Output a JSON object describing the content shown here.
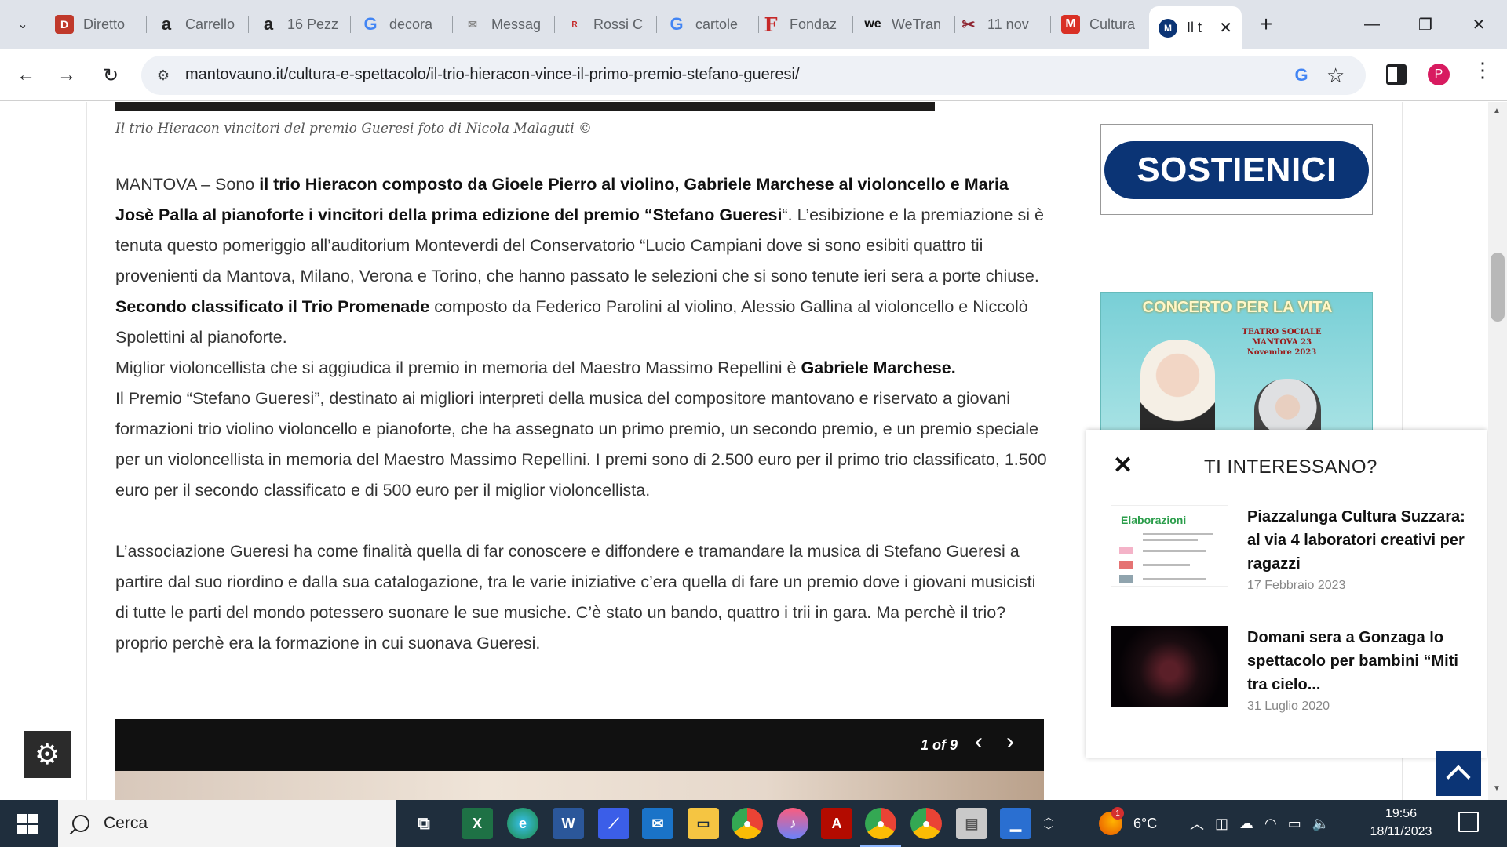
{
  "browser": {
    "tabs": [
      {
        "title": "Diretto",
        "favicon": "bookmark-icon",
        "fav_char": "D",
        "fav_color": "#c0392b"
      },
      {
        "title": "Carrello",
        "favicon": "amazon-icon",
        "fav_char": "a",
        "fav_color": "#222222"
      },
      {
        "title": "16 Pezz",
        "favicon": "amazon-icon",
        "fav_char": "a",
        "fav_color": "#222222"
      },
      {
        "title": "decora",
        "favicon": "google-icon",
        "fav_char": "G",
        "fav_color": "#4285f4"
      },
      {
        "title": "Messag",
        "favicon": "message-icon",
        "fav_char": "✉",
        "fav_color": "#888888"
      },
      {
        "title": "Rossi C",
        "favicon": "rossi-carta-icon",
        "fav_char": "R",
        "fav_color": "#c62828"
      },
      {
        "title": "cartole",
        "favicon": "google-icon",
        "fav_char": "G",
        "fav_color": "#4285f4"
      },
      {
        "title": "Fondaz",
        "favicon": "fondazione-icon",
        "fav_char": "F",
        "fav_color": "#c62828"
      },
      {
        "title": "WeTran",
        "favicon": "wetransfer-icon",
        "fav_char": "we",
        "fav_color": "#111111"
      },
      {
        "title": "11 nov",
        "favicon": "scissors-icon",
        "fav_char": "✂",
        "fav_color": "#8e2430"
      },
      {
        "title": "Cultura",
        "favicon": "gmail-icon",
        "fav_char": "M",
        "fav_color": "#d93025"
      },
      {
        "title": "Il t",
        "favicon": "mantovauno-icon",
        "fav_char": "M",
        "fav_color": "#0b3475",
        "active": true
      }
    ],
    "url": "mantovauno.it/cultura-e-spettacolo/il-trio-hieracon-vince-il-primo-premio-stefano-gueresi/",
    "profile_initial": "P"
  },
  "article": {
    "photo_caption": "Il trio Hieracon vincitori del premio Gueresi foto di Nicola Malaguti ©",
    "p1_a": "MANTOVA – Sono ",
    "p1_b": "il trio Hieracon composto da Gioele Pierro al violino, Gabriele Marchese al violoncello e Maria Josè Palla al pianoforte i vincitori della prima edizione del premio “Stefano Gueresi",
    "p1_c": "“. L’esibizione e la premiazione si è tenuta questo pomeriggio all’auditorium Monteverdi del Conservatorio “Lucio Campiani dove si sono esibiti quattro tii provenienti da Mantova, Milano, Verona e Torino, che hanno passato le selezioni che si sono tenute ieri sera a porte chiuse.",
    "p2_a": "Secondo classificato il Trio Promenade",
    "p2_b": " composto da Federico Parolini al violino, Alessio Gallina al violoncello e Niccolò Spolettini al pianoforte.",
    "p3_a": "Miglior violoncellista che si aggiudica il premio in memoria del Maestro Massimo Repellini è ",
    "p3_b": "Gabriele Marchese.",
    "p4": "Il Premio “Stefano Gueresi”, destinato ai migliori interpreti della musica del compositore mantovano e riservato a giovani formazioni trio violino violoncello e pianoforte, che ha assegnato un primo premio, un secondo premio, e un premio speciale per un violoncellista in memoria del Maestro Massimo Repellini. I premi sono di 2.500 euro per il primo trio classificato, 1.500 euro per il secondo classificato e di 500 euro per il miglior violoncellista.",
    "p5": "L’associazione Gueresi ha come finalità quella di far conoscere e diffondere e tramandare la musica di Stefano Gueresi a partire dal suo riordino e dalla sua catalogazione, tra le varie iniziative c’era quella di fare un premio dove i giovani musicisti di tutte le parti del mondo potessero suonare le sue musiche. C’è stato un bando, quattro i trii in gara. Ma perchè il trio? proprio perchè era la formazione in cui suonava Gueresi.",
    "gallery_counter": "1 of 9"
  },
  "sidebar": {
    "sostienici": "SOSTIENICI",
    "concerto_title": "CONCERTO PER LA VITA",
    "concerto_venue": "TEATRO SOCIALE MANTOVA 23 Novembre 2023"
  },
  "recommended": {
    "heading": "TI INTERESSANO?",
    "items": [
      {
        "title": "Piazzalunga Cultura Suzzara: al via 4 laboratori creativi per ragazzi",
        "date": "17 Febbraio 2023",
        "thumb_text": "Elaborazioni"
      },
      {
        "title": "Domani sera a Gonzaga lo spettacolo per bambini “Miti tra cielo...",
        "date": "31 Luglio 2020"
      }
    ]
  },
  "taskbar": {
    "search_placeholder": "Cerca",
    "weather": "6°C",
    "weather_badge": "1",
    "time": "19:56",
    "date": "18/11/2023",
    "apps": [
      "task-view-icon",
      "excel-icon",
      "edge-icon",
      "word-icon",
      "powerautomate-icon",
      "mail-icon",
      "file-explorer-icon",
      "chrome-icon",
      "itunes-icon",
      "acrobat-icon",
      "chrome-profile-icon",
      "chrome-icon",
      "notepad-icon",
      "remote-icon"
    ]
  },
  "colors": {
    "brand_blue": "#0b3475",
    "taskbar": "#1f2e3d",
    "tabstrip": "#dfe3ea"
  }
}
